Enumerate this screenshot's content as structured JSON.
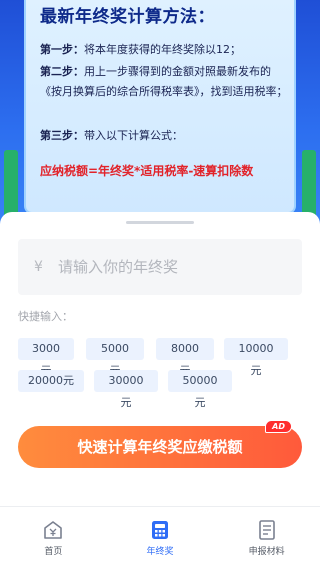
{
  "method": {
    "title": "最新年终奖计算方法：",
    "step1_label": "第一步：",
    "step1_text": "将本年度获得的年终奖除以12；",
    "step2_label": "第二步：",
    "step2_text": "用上一步骤得到的金额对照最新发布的《按月换算后的综合所得税率表》，找到适用税率；",
    "step3_label": "第三步：",
    "step3_text": "带入以下计算公式：",
    "formula": "应纳税额=年终奖*适用税率-速算扣除数"
  },
  "input": {
    "currency_symbol": "¥",
    "placeholder": "请输入你的年终奖",
    "value": ""
  },
  "quick": {
    "label": "快捷输入：",
    "options": [
      "3000元",
      "5000元",
      "8000元",
      "10000元",
      "20000元",
      "30000元",
      "50000元"
    ]
  },
  "cta": {
    "label": "快速计算年终奖应缴税额",
    "badge": "AD"
  },
  "tabs": [
    {
      "label": "首页",
      "icon": "home-icon",
      "active": false
    },
    {
      "label": "年终奖",
      "icon": "calculator-icon",
      "active": true
    },
    {
      "label": "申报材料",
      "icon": "document-icon",
      "active": false
    }
  ],
  "colors": {
    "accent": "#2f6df6",
    "cta_start": "#ff8c3d",
    "cta_end": "#ff5a3b",
    "formula_red": "#e2232a",
    "title_navy": "#0e2a8a"
  }
}
